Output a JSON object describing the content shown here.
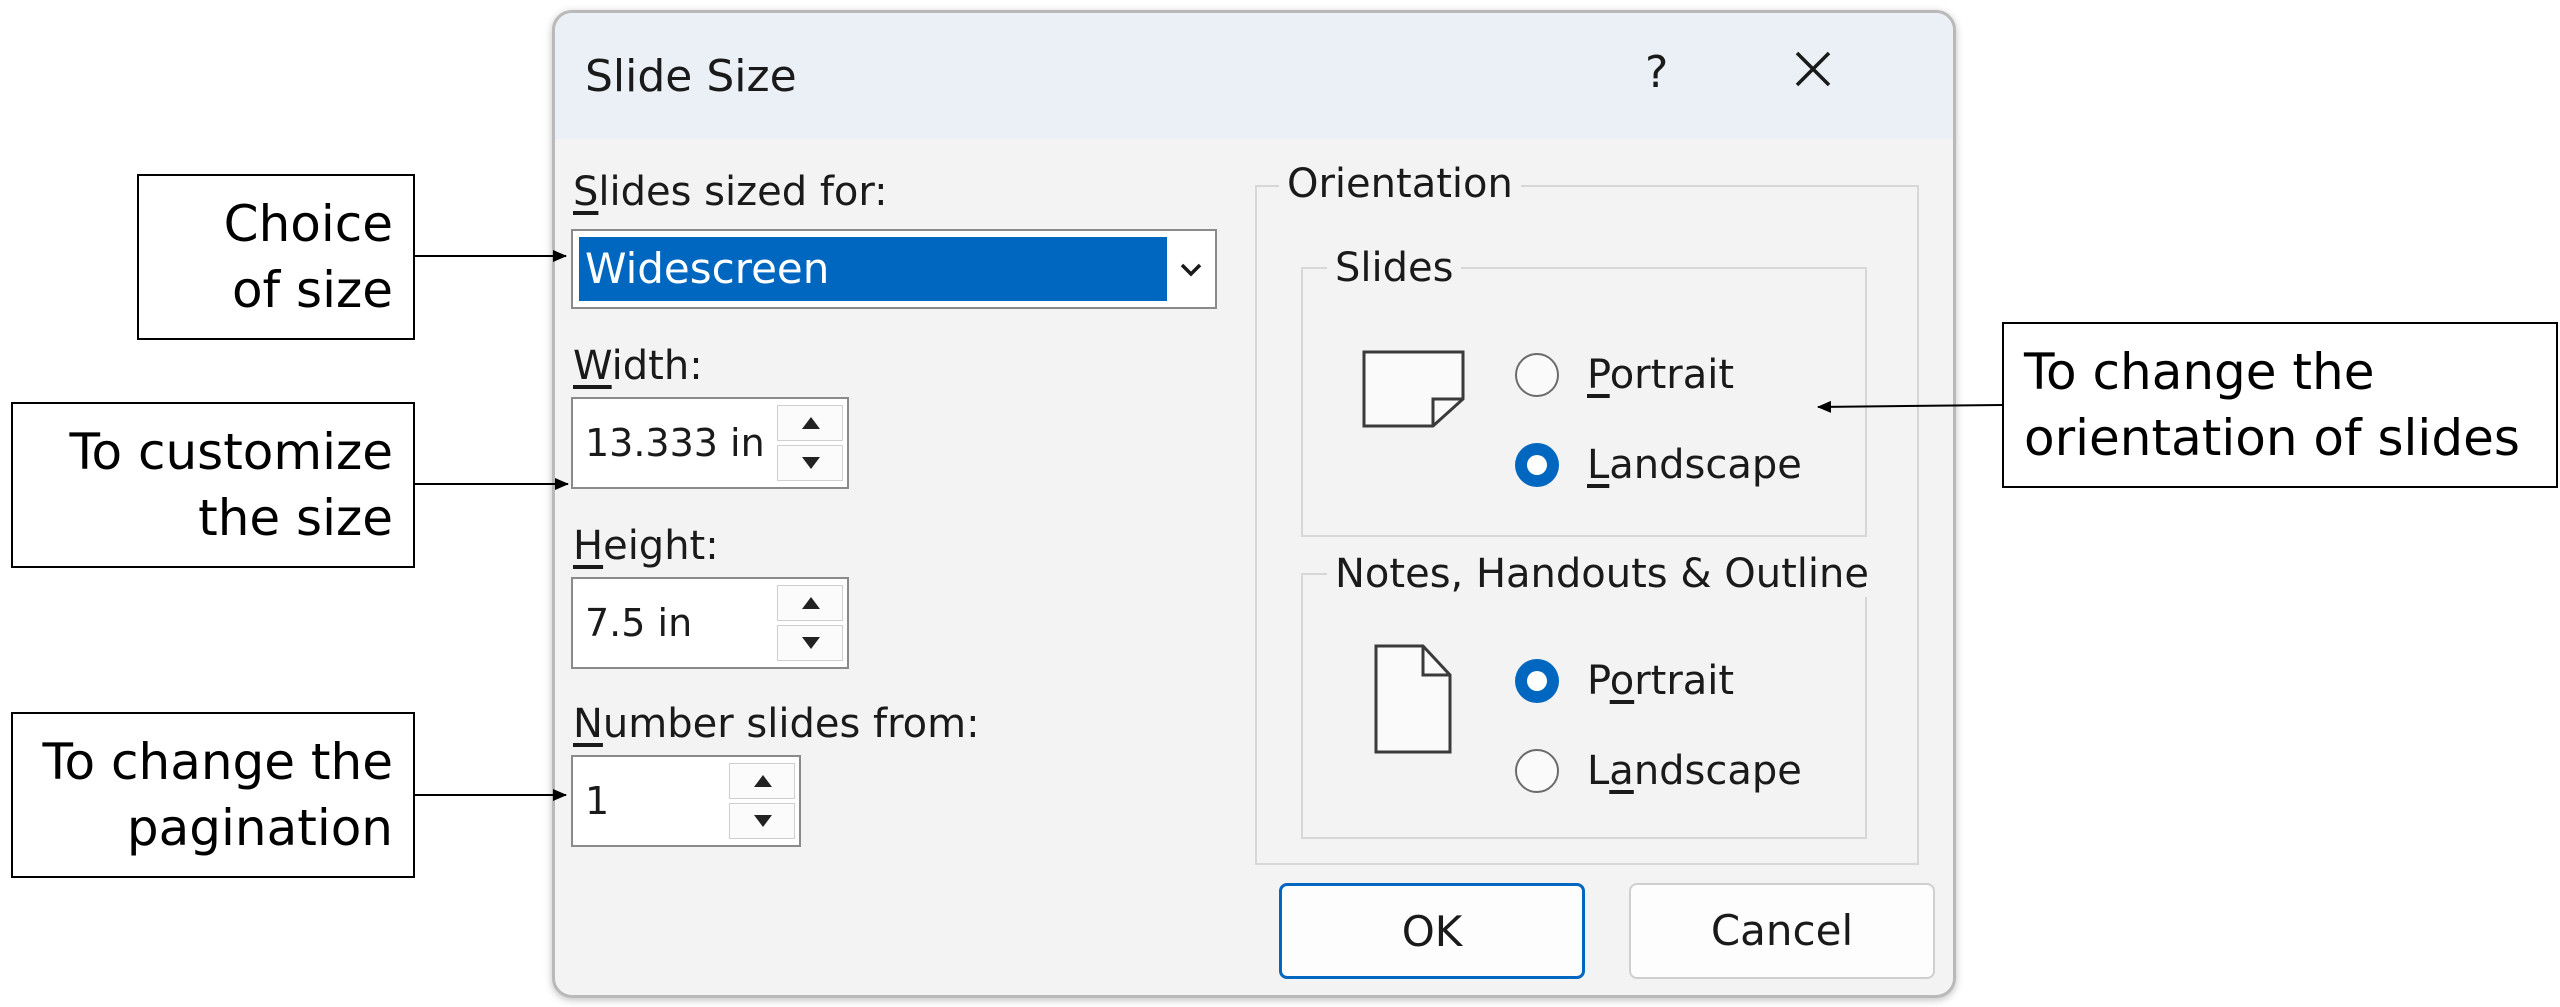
{
  "dialog": {
    "title": "Slide Size",
    "help_label": "?",
    "close_icon": "close-icon"
  },
  "size": {
    "label_key": "S",
    "label_rest": "lides sized for:",
    "selected": "Widescreen"
  },
  "width": {
    "label_key": "W",
    "label_rest": "idth:",
    "value": "13.333 in"
  },
  "height": {
    "label_key": "H",
    "label_rest": "eight:",
    "value": "7.5 in"
  },
  "number": {
    "label_key": "N",
    "label_rest": "umber slides from:",
    "value": "1"
  },
  "orientation": {
    "label": "Orientation",
    "slides": {
      "label": "Slides",
      "portrait_key": "P",
      "portrait_rest": "ortrait",
      "landscape_key": "L",
      "landscape_rest": "andscape",
      "selected": "landscape"
    },
    "notes": {
      "label": "Notes, Handouts & Outline",
      "portrait_pre": "P",
      "portrait_key": "o",
      "portrait_rest": "rtrait",
      "landscape_pre": "L",
      "landscape_key": "a",
      "landscape_rest": "ndscape",
      "selected": "portrait"
    }
  },
  "buttons": {
    "ok": "OK",
    "cancel": "Cancel"
  },
  "callouts": {
    "size": [
      "Choice",
      "of size"
    ],
    "customize": [
      "To customize",
      "the size"
    ],
    "pagination": [
      "To change the",
      "pagination"
    ],
    "orientation": [
      "To change the",
      "orientation of slides"
    ]
  },
  "colors": {
    "accent": "#0067c0",
    "dialog_bg": "#f3f3f3",
    "titlebar_bg": "#eaf0f5"
  }
}
